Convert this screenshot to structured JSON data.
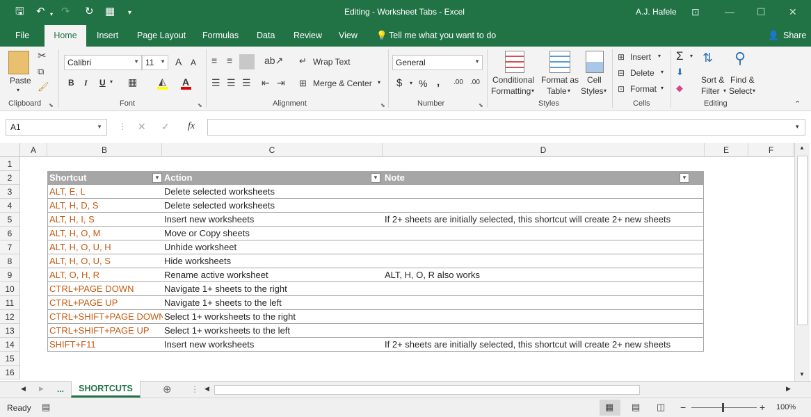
{
  "title": {
    "text": "Editing - Worksheet Tabs  -  Excel",
    "user": "A.J. Hafele"
  },
  "tabs": [
    "File",
    "Home",
    "Insert",
    "Page Layout",
    "Formulas",
    "Data",
    "Review",
    "View"
  ],
  "tell_me": "Tell me what you want to do",
  "share": "Share",
  "ribbon": {
    "clipboard": {
      "paste": "Paste",
      "label": "Clipboard"
    },
    "font": {
      "name": "Calibri",
      "size": "11",
      "label": "Font",
      "bold": "B",
      "italic": "I",
      "underline": "U",
      "grow": "A",
      "shrink": "A",
      "color_letter": "A"
    },
    "alignment": {
      "wrap": "Wrap Text",
      "merge": "Merge & Center",
      "label": "Alignment"
    },
    "number": {
      "format": "General",
      "label": "Number",
      "currency": "$",
      "percent": "%",
      "comma": ",",
      "inc_dec": ".00",
      "dec_dec": ".00"
    },
    "styles": {
      "cond1": "Conditional",
      "cond2": "Formatting",
      "fmt1": "Format as",
      "fmt2": "Table",
      "cell1": "Cell",
      "cell2": "Styles",
      "label": "Styles"
    },
    "cells": {
      "insert": "Insert",
      "delete": "Delete",
      "format": "Format",
      "label": "Cells"
    },
    "editing": {
      "sort1": "Sort &",
      "sort2": "Filter",
      "find1": "Find &",
      "find2": "Select",
      "label": "Editing",
      "sum": "Σ"
    }
  },
  "namebox": "A1",
  "fx": "fx",
  "columns": [
    "A",
    "B",
    "C",
    "D",
    "E",
    "F"
  ],
  "rows": [
    "1",
    "2",
    "3",
    "4",
    "5",
    "6",
    "7",
    "8",
    "9",
    "10",
    "11",
    "12",
    "13",
    "14",
    "15",
    "16"
  ],
  "table": {
    "headers": [
      "Shortcut",
      "Action",
      "Note"
    ],
    "rows": [
      [
        "ALT, E, L",
        "Delete selected worksheets",
        ""
      ],
      [
        "ALT, H, D, S",
        "Delete selected worksheets",
        ""
      ],
      [
        "ALT, H, I, S",
        "Insert new worksheets",
        "If 2+ sheets are initially selected, this shortcut will create 2+ new sheets"
      ],
      [
        "ALT, H, O, M",
        "Move or Copy sheets",
        ""
      ],
      [
        "ALT, H, O, U, H",
        "Unhide worksheet",
        ""
      ],
      [
        "ALT, H, O, U, S",
        "Hide worksheets",
        ""
      ],
      [
        "ALT, O, H, R",
        "Rename active worksheet",
        "ALT, H, O, R also works"
      ],
      [
        "CTRL+PAGE DOWN",
        "Navigate 1+ sheets to the right",
        ""
      ],
      [
        "CTRL+PAGE UP",
        "Navigate 1+ sheets to the left",
        ""
      ],
      [
        "CTRL+SHIFT+PAGE DOWN",
        "Select 1+ worksheets to the right",
        ""
      ],
      [
        "CTRL+SHIFT+PAGE UP",
        "Select 1+ worksheets to the left",
        ""
      ],
      [
        "SHIFT+F11",
        "Insert new worksheets",
        "If 2+ sheets are initially selected, this shortcut will create 2+ new sheets"
      ]
    ]
  },
  "sheets": {
    "ellipsis": "...",
    "active": "SHORTCUTS"
  },
  "status": {
    "ready": "Ready",
    "zoom": "100%"
  },
  "colors": {
    "excel_green": "#217346",
    "shortcut_text": "#c55a11",
    "table_header": "#a6a6a6"
  }
}
